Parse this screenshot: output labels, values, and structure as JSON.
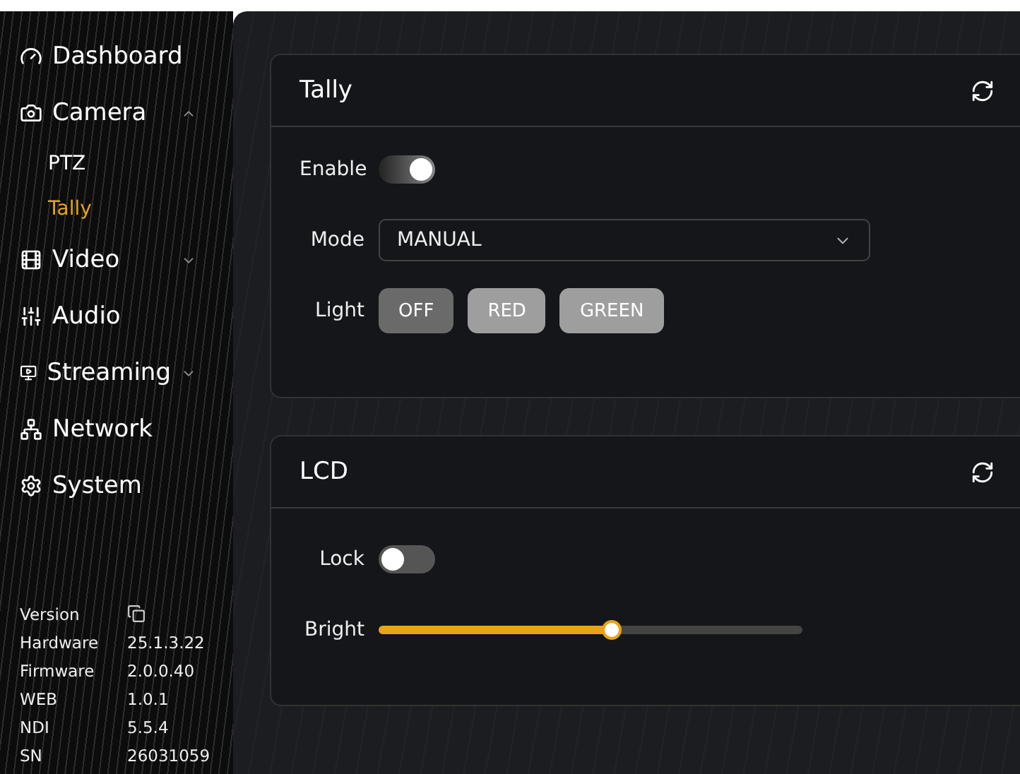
{
  "sidebar": {
    "items": [
      {
        "label": "Dashboard"
      },
      {
        "label": "Camera",
        "expanded": true,
        "children": [
          {
            "label": "PTZ",
            "selected": false
          },
          {
            "label": "Tally",
            "selected": true
          }
        ]
      },
      {
        "label": "Video",
        "expanded": false
      },
      {
        "label": "Audio"
      },
      {
        "label": "Streaming",
        "expanded": false
      },
      {
        "label": "Network"
      },
      {
        "label": "System"
      }
    ],
    "version": {
      "title": "Version",
      "rows": [
        {
          "label": "Hardware",
          "value": "25.1.3.22"
        },
        {
          "label": "Firmware",
          "value": "2.0.0.40"
        },
        {
          "label": "WEB",
          "value": "1.0.1"
        },
        {
          "label": "NDI",
          "value": "5.5.4"
        },
        {
          "label": "SN",
          "value": "26031059"
        }
      ]
    }
  },
  "tally": {
    "title": "Tally",
    "enable": {
      "label": "Enable",
      "on": true
    },
    "mode": {
      "label": "Mode",
      "value": "MANUAL"
    },
    "light": {
      "label": "Light",
      "options": [
        {
          "label": "OFF",
          "selected": true
        },
        {
          "label": "RED",
          "selected": false
        },
        {
          "label": "GREEN",
          "selected": false
        }
      ]
    }
  },
  "lcd": {
    "title": "LCD",
    "lock": {
      "label": "Lock",
      "on": false
    },
    "bright": {
      "label": "Bright",
      "level": 0.55
    }
  }
}
